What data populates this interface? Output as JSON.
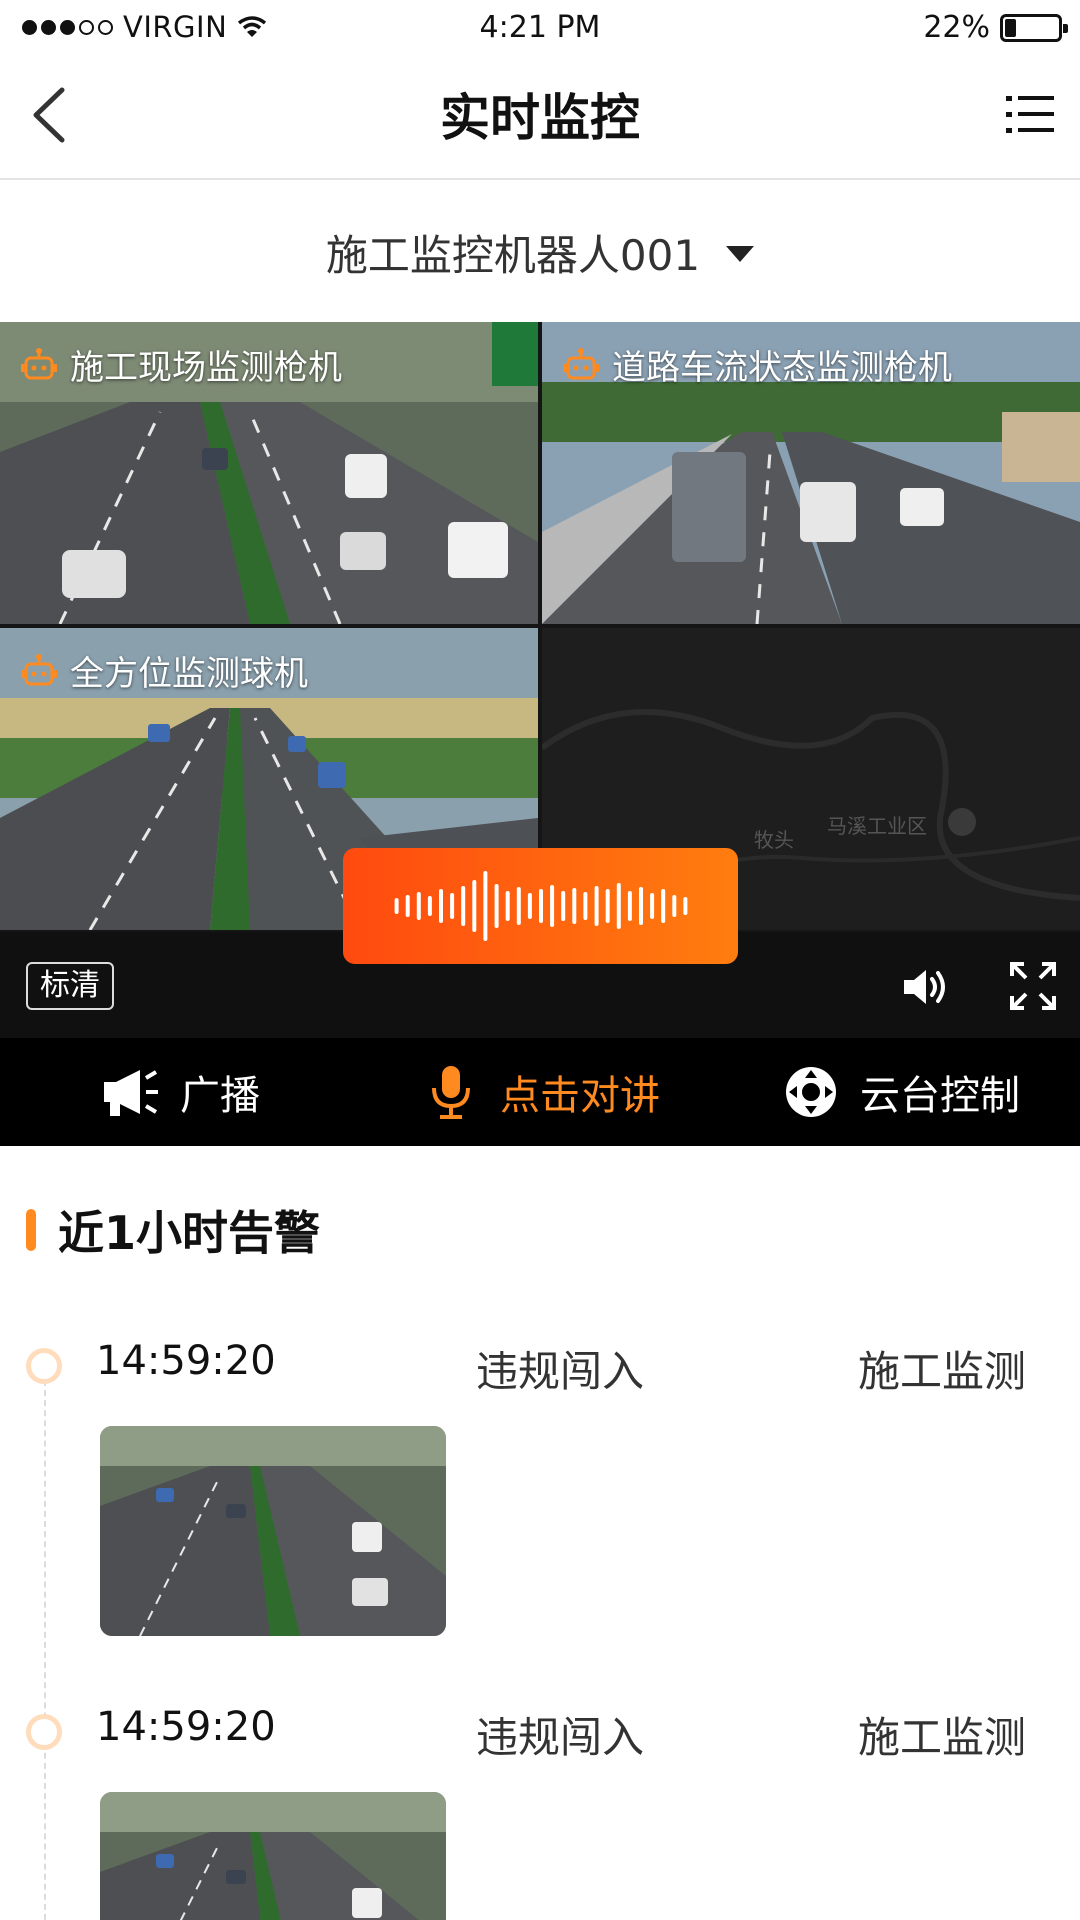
{
  "status_bar": {
    "carrier": "VIRGIN",
    "time": "4:21 PM",
    "battery": "22%",
    "battery_level": 0.22,
    "signal_bars": 3,
    "signal_total": 5
  },
  "nav": {
    "title": "实时监控",
    "back_icon": "chevron-left-icon",
    "menu_icon": "list-menu-icon"
  },
  "device_selector": {
    "selected": "施工监控机器人001"
  },
  "cameras": [
    {
      "label": "施工现场监测枪机"
    },
    {
      "label": "道路车流状态监测枪机"
    },
    {
      "label": "全方位监测球机"
    }
  ],
  "map_tile": {
    "place_1": "马溪工业区",
    "place_2": "牧头"
  },
  "video_controls": {
    "quality": "标清",
    "volume_icon": "speaker-icon",
    "fullscreen_icon": "fullscreen-icon"
  },
  "actions": {
    "broadcast": "广播",
    "talk": "点击对讲",
    "ptz": "云台控制"
  },
  "alerts": {
    "title": "近1小时告警",
    "items": [
      {
        "time": "14:59:20",
        "type": "违规闯入",
        "source": "施工监测"
      },
      {
        "time": "14:59:20",
        "type": "违规闯入",
        "source": "施工监测"
      }
    ]
  },
  "colors": {
    "accent": "#ff8a1f",
    "gradient_start": "#ff4a0f",
    "gradient_end": "#ff7d0f"
  }
}
